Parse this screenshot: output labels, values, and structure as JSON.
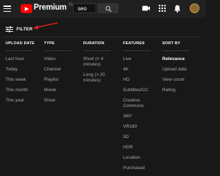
{
  "header": {
    "brand": "Premium",
    "region": "CL",
    "search_value": "seo",
    "search_icon": "search-icon",
    "icons": [
      "hamburger-menu-icon",
      "create-video-icon",
      "apps-grid-icon",
      "notifications-bell-icon"
    ],
    "accent_color": "#ff0000"
  },
  "filter": {
    "label": "FILTER",
    "icon": "tune-icon",
    "annotation_color": "#e02020"
  },
  "columns": [
    {
      "heading": "UPLOAD DATE",
      "items": [
        "Last hour",
        "Today",
        "This week",
        "This month",
        "This year"
      ]
    },
    {
      "heading": "TYPE",
      "items": [
        "Video",
        "Channel",
        "Playlist",
        "Movie",
        "Show"
      ]
    },
    {
      "heading": "DURATION",
      "items": [
        "Short (< 4 minutes)",
        "Long (> 20 minutes)"
      ]
    },
    {
      "heading": "FEATURES",
      "items": [
        "Live",
        "4K",
        "HD",
        "Subtitles/CC",
        "Creative Commons",
        "360°",
        "VR180",
        "3D",
        "HDR",
        "Location",
        "Purchased"
      ]
    },
    {
      "heading": "SORT BY",
      "items": [
        "Relevance",
        "Upload date",
        "View count",
        "Rating"
      ],
      "selected": "Relevance"
    }
  ]
}
